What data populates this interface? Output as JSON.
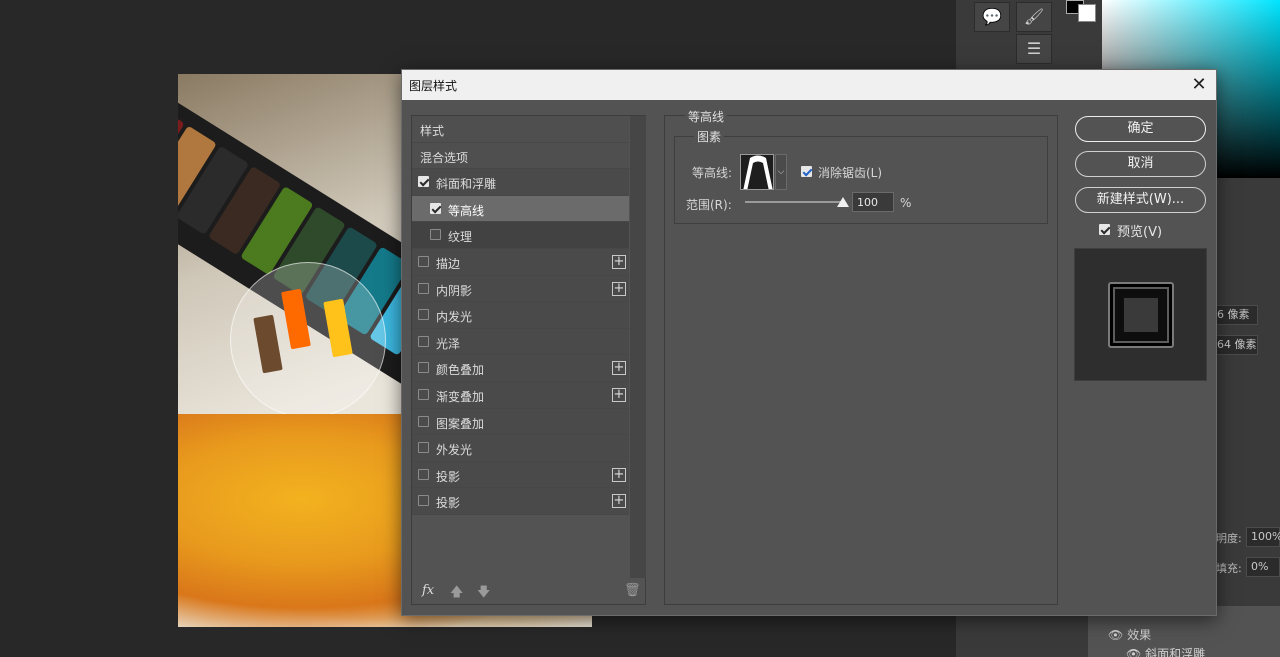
{
  "dialog": {
    "title": "图层样式",
    "close_icon": "close-icon"
  },
  "style_list": {
    "items": [
      {
        "label": "样式",
        "checkbox": null,
        "plus": false
      },
      {
        "label": "混合选项",
        "checkbox": null,
        "plus": false
      },
      {
        "label": "斜面和浮雕",
        "checkbox": true,
        "plus": false
      },
      {
        "label": "等高线",
        "checkbox": true,
        "plus": false,
        "selected": true
      },
      {
        "label": "纹理",
        "checkbox": false,
        "plus": false
      },
      {
        "label": "描边",
        "checkbox": false,
        "plus": true
      },
      {
        "label": "内阴影",
        "checkbox": false,
        "plus": true
      },
      {
        "label": "内发光",
        "checkbox": false,
        "plus": false
      },
      {
        "label": "光泽",
        "checkbox": false,
        "plus": false
      },
      {
        "label": "颜色叠加",
        "checkbox": false,
        "plus": true
      },
      {
        "label": "渐变叠加",
        "checkbox": false,
        "plus": true
      },
      {
        "label": "图案叠加",
        "checkbox": false,
        "plus": false
      },
      {
        "label": "外发光",
        "checkbox": false,
        "plus": false
      },
      {
        "label": "投影",
        "checkbox": false,
        "plus": true
      },
      {
        "label": "投影",
        "checkbox": false,
        "plus": true
      }
    ],
    "footer": {
      "fx_label": "fx",
      "up_icon": "arrow-up-icon",
      "down_icon": "arrow-down-icon",
      "trash_icon": "trash-icon"
    }
  },
  "contour_panel": {
    "group_title": "等高线",
    "subgroup_title": "图素",
    "contour_label": "等高线:",
    "anti_alias_label": "消除锯齿(L)",
    "anti_alias_checked": true,
    "range_label": "范围(R):",
    "range_value": "100",
    "range_unit": "%",
    "range_fraction": 1.0
  },
  "buttons": {
    "ok": "确定",
    "cancel": "取消",
    "new_style": "新建样式(W)...",
    "preview_label": "预览(V)",
    "preview_checked": true
  },
  "background_panel": {
    "field1": "6 像素",
    "field2": "64 像素",
    "opacity_label": "明度:",
    "opacity_value": "100%",
    "fill_label": "填充:",
    "fill_value": "0%",
    "effects_label": "效果",
    "effect_item": "斜面和浮雕"
  },
  "colors": {
    "dialog_bg": "#535353",
    "titlebar_bg": "#f0f0f0",
    "selected_row": "#6b6b6b",
    "checkbox_accent": "#2463c9"
  }
}
